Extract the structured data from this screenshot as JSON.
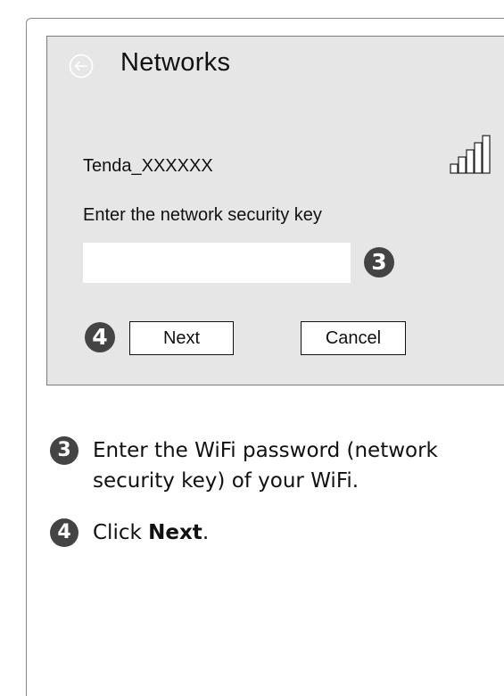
{
  "screen": {
    "title": "Networks",
    "network_name": "Tenda_XXXXXX",
    "key_label": "Enter the network security key",
    "key_input": {
      "value": "",
      "placeholder": ""
    },
    "step_badge_input": "3",
    "step_badge_buttons": "4",
    "next_label": "Next",
    "cancel_label": "Cancel",
    "icons": {
      "back": "back-arrow-circle-icon",
      "signal": "wifi-signal-bars-icon"
    }
  },
  "instructions": {
    "step3": {
      "number": "3",
      "text": "Enter the WiFi password (network security key) of your WiFi."
    },
    "step4": {
      "number": "4",
      "prefix": "Click ",
      "bold": "Next",
      "suffix": "."
    }
  },
  "colors": {
    "screen_background": "#e6e6e6",
    "badge": "#444444",
    "input_background": "#ffffff"
  }
}
